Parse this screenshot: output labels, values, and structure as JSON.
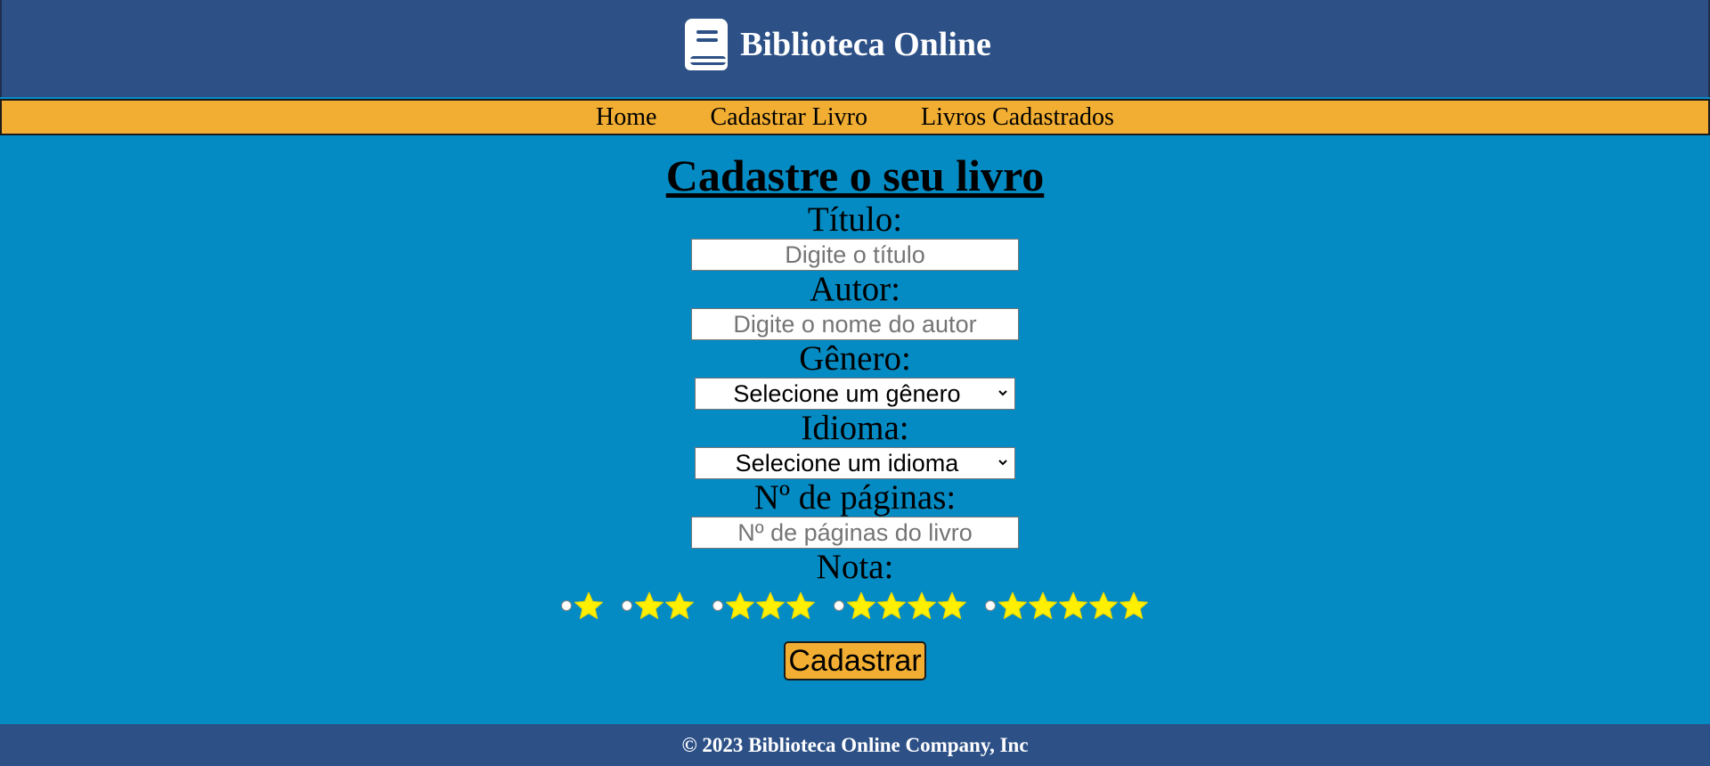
{
  "header": {
    "title": "Biblioteca Online",
    "logo_icon": "book-icon",
    "background": "#2d5187"
  },
  "nav": {
    "items": [
      {
        "label": "Home"
      },
      {
        "label": "Cadastrar Livro"
      },
      {
        "label": "Livros Cadastrados"
      }
    ],
    "background": "#f1ae33"
  },
  "form": {
    "heading": "Cadastre o seu livro",
    "title_field": {
      "label": "Título:",
      "value": "",
      "placeholder": "Digite o título"
    },
    "author_field": {
      "label": "Autor:",
      "value": "",
      "placeholder": "Digite o nome do autor"
    },
    "genre_field": {
      "label": "Gênero:",
      "selected": "Selecione um gênero"
    },
    "language_field": {
      "label": "Idioma:",
      "selected": "Selecione um idioma"
    },
    "pages_field": {
      "label": "Nº de páginas:",
      "value": "",
      "placeholder": "Nº de páginas do livro"
    },
    "rating_field": {
      "label": "Nota:",
      "options": [
        1,
        2,
        3,
        4,
        5
      ],
      "star_icon": "star-icon",
      "star_color": "#ffef00"
    },
    "submit_label": "Cadastrar"
  },
  "page": {
    "background": "#058bc3"
  },
  "footer": {
    "text": "© 2023 Biblioteca Online Company, Inc"
  }
}
